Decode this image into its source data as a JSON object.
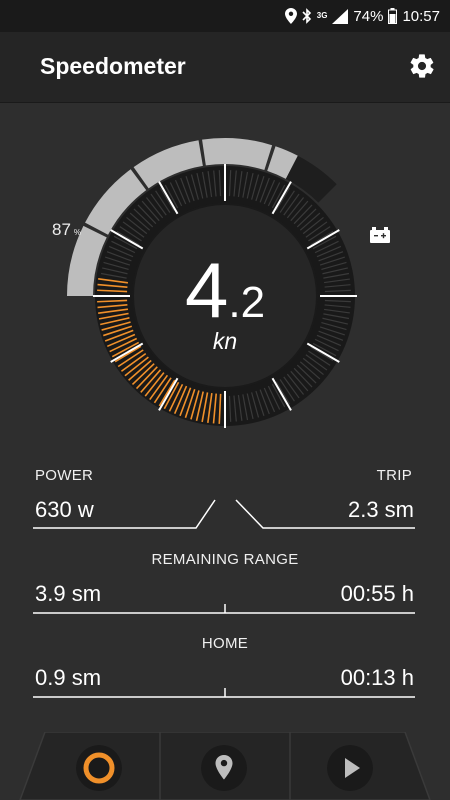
{
  "status_bar": {
    "battery_percent": "74%",
    "time": "10:57",
    "network": "3G"
  },
  "app_bar": {
    "title": "Speedometer",
    "settings_icon": "gear-icon"
  },
  "gauge": {
    "speed_integer": "4",
    "speed_decimal": ".2",
    "speed_unit": "kn",
    "battery_level": "87",
    "battery_unit": "%",
    "battery_icon": "battery-icon",
    "power_fraction_of_scale": 0.28,
    "battery_fraction": 0.87,
    "colors": {
      "accent": "#f0902a",
      "tick": "#ffffff",
      "bezel": "#1c1c1c",
      "arc_light": "#bdbdbd",
      "arc_dark": "#1e1e1e"
    }
  },
  "power_trip": {
    "power_label": "POWER",
    "power_value": "630 w",
    "trip_label": "TRIP",
    "trip_value": "2.3 sm"
  },
  "remaining_range": {
    "label": "REMAINING RANGE",
    "distance": "3.9 sm",
    "time": "00:55 h"
  },
  "home": {
    "label": "HOME",
    "distance": "0.9 sm",
    "time": "00:13 h"
  },
  "bottom_nav": {
    "items": [
      {
        "icon": "ring-icon",
        "active": true
      },
      {
        "icon": "location-pin-icon",
        "active": false
      },
      {
        "icon": "play-icon",
        "active": false
      }
    ]
  }
}
